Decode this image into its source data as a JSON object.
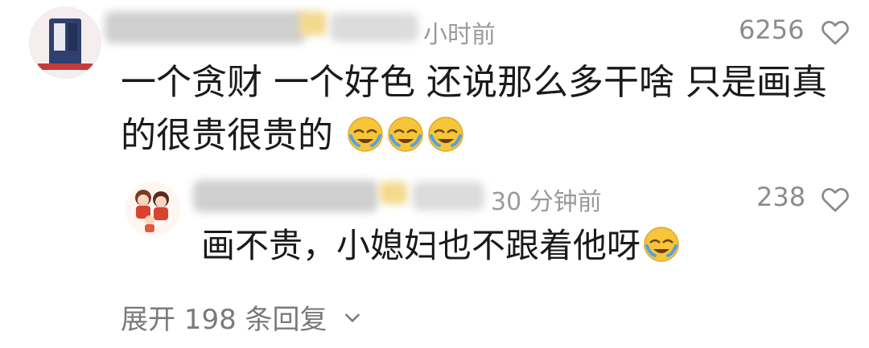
{
  "comment": {
    "avatar_icon": "product-box-avatar-icon",
    "time": "小时前",
    "like_count": "6256",
    "text": "一个贪财 一个好色 还说那么多干啥 只是画真的很贵很贵的",
    "emojis": [
      "crying-laughing-face-icon",
      "crying-laughing-face-icon",
      "crying-laughing-face-icon"
    ]
  },
  "reply": {
    "avatar_icon": "cartoon-family-avatar-icon",
    "time": "30 分钟前",
    "like_count": "238",
    "text": "画不贵，小媳妇也不跟着他呀",
    "emojis": [
      "crying-laughing-face-icon"
    ]
  },
  "expand": {
    "label": "展开 198 条回复",
    "icon": "chevron-down-icon"
  },
  "colors": {
    "text_primary": "#1a1a1a",
    "text_secondary": "#9a9a9a",
    "emoji_yellow": "#f7c53a"
  }
}
